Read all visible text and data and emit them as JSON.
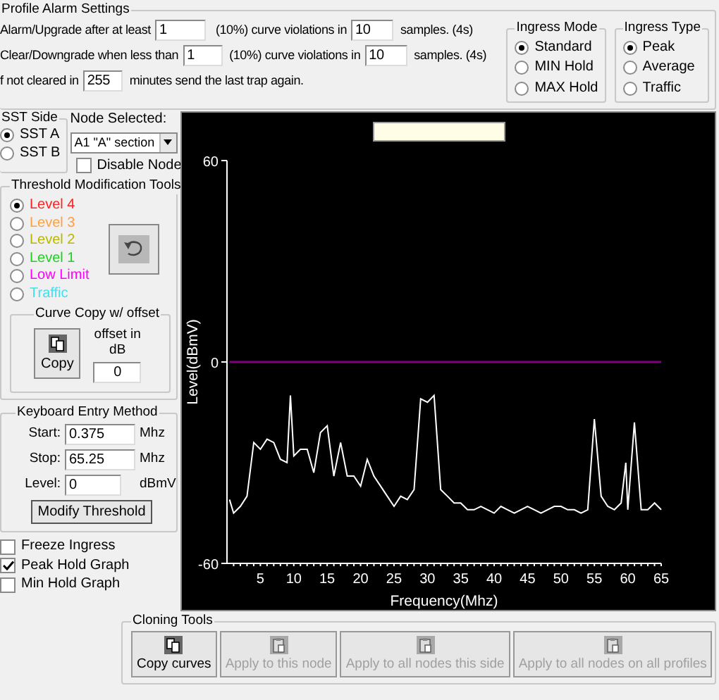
{
  "profile_alarm_settings": {
    "title": "Profile Alarm Settings",
    "rows": [
      {
        "label": "Alarm/Upgrade after at least",
        "value": "1",
        "middle": "(10%) curve violations in",
        "value2": "10",
        "suffix": "samples. (4s)"
      },
      {
        "label": "Clear/Downgrade when less than",
        "value": "1",
        "middle": "(10%) curve violations in",
        "value2": "10",
        "suffix": "samples. (4s)"
      },
      {
        "label": "f not cleared in",
        "value": "255",
        "suffix": "minutes send the last trap again."
      }
    ]
  },
  "ingress_mode": {
    "title": "Ingress Mode",
    "options": [
      {
        "label": "Standard",
        "selected": true
      },
      {
        "label": "MIN Hold",
        "selected": false
      },
      {
        "label": "MAX Hold",
        "selected": false
      }
    ]
  },
  "ingress_type": {
    "title": "Ingress Type",
    "options": [
      {
        "label": "Peak",
        "selected": true
      },
      {
        "label": "Average",
        "selected": false
      },
      {
        "label": "Traffic",
        "selected": false
      }
    ]
  },
  "sst_side": {
    "title": "SST Side",
    "options": [
      {
        "label": "SST A",
        "selected": true
      },
      {
        "label": "SST B",
        "selected": false
      }
    ]
  },
  "node_selected": {
    "label": "Node Selected:",
    "value": "A1 \"A\" section"
  },
  "disable_node": {
    "label": "Disable Node",
    "checked": false
  },
  "threshold_tools": {
    "title": "Threshold Modification Tools",
    "levels": [
      {
        "label": "Level 4",
        "color": "#ff2020",
        "selected": true
      },
      {
        "label": "Level 3",
        "color": "#ffa040",
        "selected": false
      },
      {
        "label": "Level 2",
        "color": "#b8b800",
        "selected": false
      },
      {
        "label": "Level 1",
        "color": "#20d020",
        "selected": false
      },
      {
        "label": "Low Limit",
        "color": "#ff00ff",
        "selected": false
      },
      {
        "label": "Traffic",
        "color": "#40e0f0",
        "selected": false
      }
    ]
  },
  "curve_copy": {
    "title": "Curve Copy w/ offset",
    "button": "Copy",
    "offset_label": "offset in dB",
    "offset_value": "0"
  },
  "keyboard_entry": {
    "title": "Keyboard Entry Method",
    "fields": [
      {
        "label": "Start:",
        "value": "0.375",
        "unit": "Mhz"
      },
      {
        "label": "Stop:",
        "value": "65.25",
        "unit": "Mhz"
      },
      {
        "label": "Level:",
        "value": "0",
        "unit": "dBmV"
      }
    ],
    "button": "Modify Threshold"
  },
  "graph_options": [
    {
      "label": "Freeze Ingress",
      "checked": false
    },
    {
      "label": "Peak Hold Graph",
      "checked": true
    },
    {
      "label": "Min Hold Graph",
      "checked": false
    }
  ],
  "chart": {
    "chart_data": {
      "type": "line",
      "xlabel": "Frequency(Mhz)",
      "ylabel": "Level(dBmV)",
      "xlim": [
        0,
        65
      ],
      "ylim": [
        -60,
        60
      ],
      "xticks": [
        5,
        10,
        15,
        20,
        25,
        30,
        35,
        40,
        45,
        50,
        55,
        60,
        65
      ],
      "yticks": [
        -60,
        0,
        60
      ],
      "x": [
        0.375,
        1,
        2,
        3,
        4,
        5,
        6,
        7,
        8,
        9,
        9.5,
        10,
        11,
        12,
        13,
        14,
        15,
        16,
        17,
        18,
        19,
        20,
        21,
        22,
        23,
        24,
        25,
        26,
        27,
        28,
        29,
        30,
        31,
        32,
        33,
        34,
        35,
        36,
        37,
        38,
        39,
        40,
        41,
        42,
        43,
        44,
        45,
        46,
        47,
        48,
        49,
        50,
        51,
        52,
        53,
        54,
        55,
        56,
        57,
        58,
        59,
        59.7,
        60,
        61,
        62,
        63,
        64,
        65
      ],
      "series": [
        {
          "color": "#ffffff",
          "values": [
            -41,
            -45,
            -43,
            -40,
            -24,
            -26,
            -23,
            -24,
            -29,
            -30,
            -10,
            -28,
            -26,
            -26,
            -33,
            -21,
            -19,
            -34,
            -24,
            -34,
            -34,
            -37,
            -29,
            -34,
            -37,
            -40,
            -43,
            -40,
            -41,
            -38,
            -11,
            -12,
            -10,
            -38,
            -40,
            -42,
            -42,
            -44,
            -44,
            -43,
            -44,
            -45,
            -43,
            -44,
            -45,
            -44,
            -43,
            -44,
            -45,
            -44,
            -43,
            -43,
            -44,
            -44,
            -45,
            -44,
            -17,
            -40,
            -43,
            -44,
            -42,
            -30,
            -44,
            -18,
            -44,
            -44,
            -42,
            -44
          ]
        },
        {
          "color": "#800080",
          "values": [
            0,
            0,
            0,
            0,
            0,
            0,
            0,
            0,
            0,
            0,
            0,
            0,
            0,
            0,
            0,
            0,
            0,
            0,
            0,
            0,
            0,
            0,
            0,
            0,
            0,
            0,
            0,
            0,
            0,
            0,
            0,
            0,
            0,
            0,
            0,
            0,
            0,
            0,
            0,
            0,
            0,
            0,
            0,
            0,
            0,
            0,
            0,
            0,
            0,
            0,
            0,
            0,
            0,
            0,
            0,
            0,
            0,
            0,
            0,
            0,
            0,
            0,
            0,
            0,
            0,
            0,
            0,
            0
          ]
        }
      ]
    }
  },
  "cloning_tools": {
    "title": "Cloning Tools",
    "buttons": [
      {
        "label": "Copy curves",
        "disabled": false
      },
      {
        "label": "Apply to this node",
        "disabled": true
      },
      {
        "label": "Apply to all nodes this side",
        "disabled": true
      },
      {
        "label": "Apply to all nodes on all profiles",
        "disabled": true
      }
    ]
  }
}
